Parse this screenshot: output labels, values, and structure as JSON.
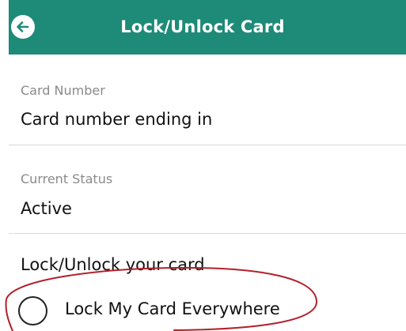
{
  "header": {
    "title": "Lock/Unlock Card",
    "background_color": "#1e8a78",
    "back_icon": "arrow-left-icon"
  },
  "card_number": {
    "label": "Card Number",
    "value": "Card number ending in"
  },
  "current_status": {
    "label": "Current Status",
    "value": "Active"
  },
  "lock_section": {
    "heading": "Lock/Unlock your card",
    "options": [
      {
        "label": "Lock My Card Everywhere",
        "selected": false
      }
    ]
  },
  "annotation": {
    "shape": "ellipse",
    "color": "#b3202a"
  }
}
